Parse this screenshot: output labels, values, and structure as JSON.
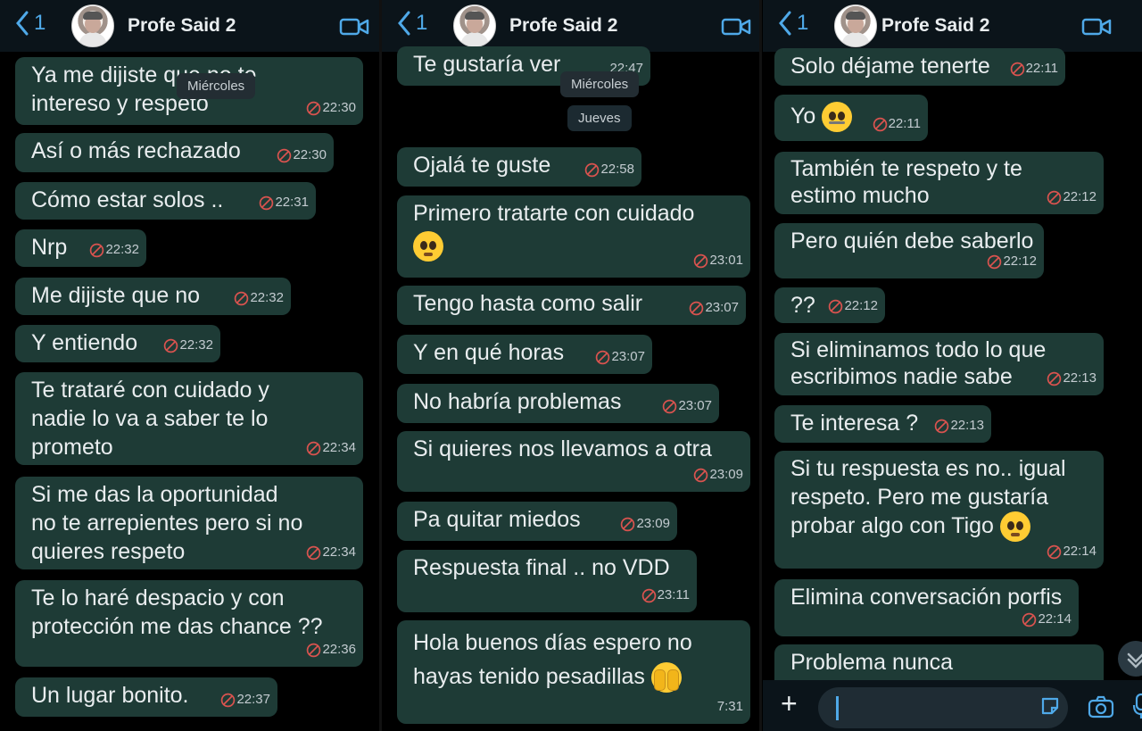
{
  "contact_name": "Profe Said 2",
  "back_count": "1",
  "panels": [
    {
      "chips": [
        {
          "label": "Miércoles"
        }
      ],
      "messages": [
        {
          "text": "Ya me dijiste que no te\nintereso y respeto",
          "time": "22:30"
        },
        {
          "text": "Así o más rechazado",
          "time": "22:30"
        },
        {
          "text": "Cómo estar solos ..",
          "time": "22:31"
        },
        {
          "text": "Nrp",
          "time": "22:32"
        },
        {
          "text": "Me dijiste que no",
          "time": "22:32"
        },
        {
          "text": "Y entiendo",
          "time": "22:32"
        },
        {
          "text": "Te trataré con cuidado y\nnadie lo va a saber te lo\nprometo",
          "time": "22:34"
        },
        {
          "text": "Si me das la oportunidad\nno te arrepientes pero si no\nquieres respeto",
          "time": "22:34"
        },
        {
          "text": "Te lo haré despacio y con\nprotección me das chance ??",
          "time": "22:36"
        },
        {
          "text": "Un lugar bonito.",
          "time": "22:37"
        }
      ]
    },
    {
      "chips": [
        {
          "label": "Miércoles"
        },
        {
          "label": "Jueves"
        }
      ],
      "messages": [
        {
          "text": "Te gustaría ver",
          "time": "22:47"
        },
        {
          "text": "Ojalá te guste",
          "time": "22:58"
        },
        {
          "text": "Primero tratarte con cuidado",
          "time": "23:01",
          "emoji": "pleading-face"
        },
        {
          "text": "Tengo hasta como salir",
          "time": "23:07"
        },
        {
          "text": "Y en qué horas",
          "time": "23:07"
        },
        {
          "text": "No habría problemas",
          "time": "23:07"
        },
        {
          "text": "Si quieres nos llevamos a otra",
          "time": "23:09"
        },
        {
          "text": "Pa quitar miedos",
          "time": "23:09"
        },
        {
          "text": "Respuesta final .. no VDD",
          "time": "23:11"
        },
        {
          "text": "Hola buenos días espero no\nhayas tenido pesadillas",
          "time": "7:31",
          "emoji": "fearful-face"
        }
      ]
    },
    {
      "chips": [],
      "messages": [
        {
          "text": "Solo déjame tenerte",
          "time": "22:11"
        },
        {
          "text": "Yo",
          "time": "22:11",
          "emoji": "zipper-mouth-face"
        },
        {
          "text": "También te respeto y te\nestimo mucho",
          "time": "22:12"
        },
        {
          "text": "Pero quién debe saberlo",
          "time": "22:12"
        },
        {
          "text": "??",
          "time": "22:12"
        },
        {
          "text": "Si eliminamos todo lo que\nescribimos nadie sabe",
          "time": "22:13"
        },
        {
          "text": "Te interesa ?",
          "time": "22:13"
        },
        {
          "text": "Si tu respuesta es no.. igual\nrespeto.  Pero me gustaría\nprobar algo con Tigo",
          "time": "22:14",
          "emoji": "pleading-face"
        },
        {
          "text": "Elimina conversación porfis",
          "time": "22:14"
        },
        {
          "text": "Problema nunca",
          "time": ""
        }
      ]
    }
  ],
  "icons": {
    "back": "chevron-left-icon",
    "video": "video-camera-icon",
    "deleted_timer": "disappearing-timer-icon",
    "attach": "plus-icon",
    "sticker": "sticker-icon",
    "camera": "camera-icon",
    "mic": "microphone-icon"
  },
  "colors": {
    "bubble": "#1e3b36",
    "accent": "#4fa9e8",
    "header": "#0b141a"
  }
}
